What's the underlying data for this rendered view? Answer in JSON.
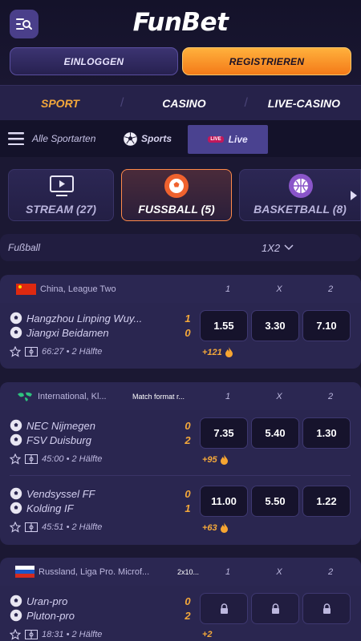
{
  "header": {
    "logo": "FunBet",
    "login": "EINLOGGEN",
    "register": "REGISTRIEREN"
  },
  "nav": {
    "sport": "SPORT",
    "casino": "CASINO",
    "live_casino": "LIVE-CASINO"
  },
  "subnav": {
    "all_sports": "Alle Sportarten",
    "sports": "Sports",
    "live": "Live",
    "live_badge": "LIVE"
  },
  "categories": [
    {
      "label": "STREAM (27)"
    },
    {
      "label": "FUSSBALL (5)"
    },
    {
      "label": "BASKETBALL (8)"
    }
  ],
  "market": {
    "sport": "Fußball",
    "type": "1X2"
  },
  "columns": {
    "c1": "1",
    "cx": "X",
    "c2": "2"
  },
  "leagues": [
    {
      "name": "China, League Two",
      "extra": "",
      "matches": [
        {
          "home": "Hangzhou Linping Wuy...",
          "away": "Jiangxi Beidamen",
          "home_score": "1",
          "away_score": "0",
          "time": "66:27 • 2 Hälfte",
          "odds": [
            "1.55",
            "3.30",
            "7.10"
          ],
          "more": "+121"
        }
      ]
    },
    {
      "name": "International, Kl...",
      "extra": "Match format r...",
      "matches": [
        {
          "home": "NEC Nijmegen",
          "away": "FSV Duisburg",
          "home_score": "0",
          "away_score": "2",
          "time": "45:00 • 2 Hälfte",
          "odds": [
            "7.35",
            "5.40",
            "1.30"
          ],
          "more": "+95"
        },
        {
          "home": "Vendsyssel FF",
          "away": "Kolding IF",
          "home_score": "0",
          "away_score": "1",
          "time": "45:51 • 2 Hälfte",
          "odds": [
            "11.00",
            "5.50",
            "1.22"
          ],
          "more": "+63"
        }
      ]
    },
    {
      "name": "Russland, Liga Pro. Microf...",
      "extra": "2x10...",
      "matches": [
        {
          "home": "Uran-pro",
          "away": "Pluton-pro",
          "home_score": "0",
          "away_score": "2",
          "time": "18:31 • 2 Hälfte",
          "odds": [
            "",
            "",
            ""
          ],
          "more": "+2"
        }
      ]
    }
  ],
  "icons": [
    "menu-search-icon",
    "hamburger-icon",
    "soccer-ball-icon",
    "stream-icon",
    "basketball-icon",
    "chevron-right-icon",
    "chevron-down-icon",
    "star-icon",
    "field-icon",
    "fire-icon",
    "lock-icon"
  ],
  "colors": {
    "accent": "#f4a83a",
    "brand_orange": "#f47a18",
    "background": "#1b1833",
    "live_red": "#c2185b"
  }
}
